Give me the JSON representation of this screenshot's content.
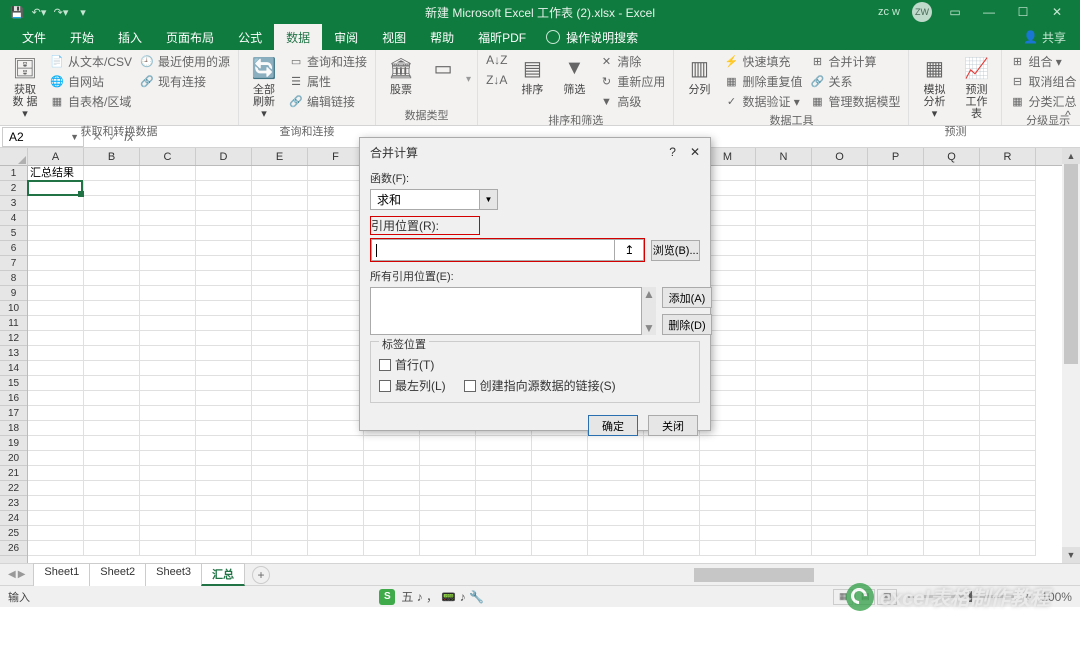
{
  "titlebar": {
    "filename": "新建 Microsoft Excel 工作表 (2).xlsx - Excel",
    "user": "zc w",
    "user_initials": "ZW"
  },
  "tabs": {
    "file": "文件",
    "home": "开始",
    "insert": "插入",
    "layout": "页面布局",
    "formulas": "公式",
    "data": "数据",
    "review": "审阅",
    "view": "视图",
    "help": "帮助",
    "foxit": "福昕PDF",
    "assist": "操作说明搜索",
    "share": "共享"
  },
  "ribbon": {
    "g1": {
      "big": "获取数\n据 ▾",
      "s1": "从文本/CSV",
      "s2": "自网站",
      "s3": "自表格/区域",
      "s4": "最近使用的源",
      "s5": "现有连接",
      "label": "获取和转换数据"
    },
    "g2": {
      "big": "全部刷新\n▾",
      "s1": "查询和连接",
      "s2": "属性",
      "s3": "编辑链接",
      "label": "查询和连接"
    },
    "g3": {
      "big1": "股票",
      "big2": "",
      "label": "数据类型"
    },
    "g4": {
      "big": "排序",
      "big2": "筛选",
      "s1": "清除",
      "s2": "重新应用",
      "s3": "高级",
      "label": "排序和筛选"
    },
    "g5": {
      "big": "分列",
      "s1": "快速填充",
      "s2": "删除重复值",
      "s3": "数据验证 ▾",
      "s4": "合并计算",
      "s5": "关系",
      "s6": "管理数据模型",
      "label": "数据工具"
    },
    "g6": {
      "big1": "模拟分析\n▾",
      "big2": "预测\n工作表",
      "label": "预测"
    },
    "g7": {
      "s1": "组合 ▾",
      "s2": "取消组合 ▾",
      "s3": "分类汇总",
      "label": "分级显示"
    }
  },
  "namebox": {
    "value": "A2",
    "fx": "fx"
  },
  "columns": [
    "A",
    "B",
    "C",
    "D",
    "E",
    "F",
    "G",
    "",
    "",
    "",
    "",
    "",
    "M",
    "N",
    "O",
    "P",
    "Q",
    "R"
  ],
  "rows": [
    "1",
    "2",
    "3",
    "4",
    "5",
    "6",
    "7",
    "8",
    "9",
    "10",
    "11",
    "12",
    "13",
    "14",
    "15",
    "16",
    "17",
    "18",
    "19",
    "20",
    "21",
    "22",
    "23",
    "24",
    "25",
    "26"
  ],
  "cell_a1": "汇总结果",
  "sheets": {
    "s1": "Sheet1",
    "s2": "Sheet2",
    "s3": "Sheet3",
    "s4": "汇总"
  },
  "statusbar": {
    "left": "输入",
    "ime": "五 ♪ ， 📟 ♪ 🔧",
    "zoom": "100%"
  },
  "dialog": {
    "title": "合并计算",
    "func_label": "函数(F):",
    "func_value": "求和",
    "ref_label": "引用位置(R):",
    "browse": "浏览(B)...",
    "all_refs_label": "所有引用位置(E):",
    "add": "添加(A)",
    "delete": "删除(D)",
    "labels": "标签位置",
    "top_row": "首行(T)",
    "left_col": "最左列(L)",
    "create_links": "创建指向源数据的链接(S)",
    "ok": "确定",
    "close": "关闭"
  },
  "watermark": "excel表格制作教程"
}
